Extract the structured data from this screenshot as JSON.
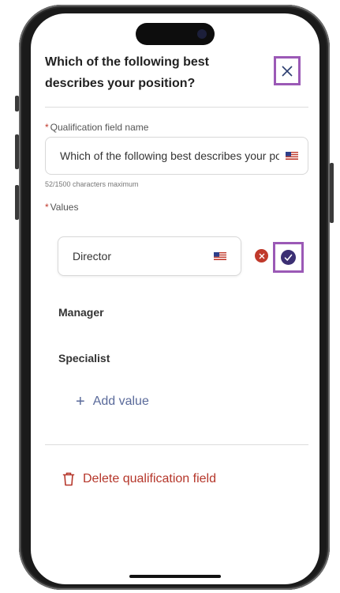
{
  "dialog": {
    "title": "Which of the following best describes your position?"
  },
  "qualification_field": {
    "label": "Qualification field name",
    "value": "Which of the following best describes your position?",
    "counter": "52/1500 characters maximum"
  },
  "values_section": {
    "label": "Values",
    "editing_value": "Director",
    "items": [
      "Manager",
      "Specialist"
    ],
    "add_label": "Add value"
  },
  "actions": {
    "delete_label": "Delete qualification field"
  },
  "colors": {
    "highlight": "#9b59b6",
    "danger": "#b5362a",
    "confirm": "#3b2f73",
    "link": "#5a6a9a"
  }
}
